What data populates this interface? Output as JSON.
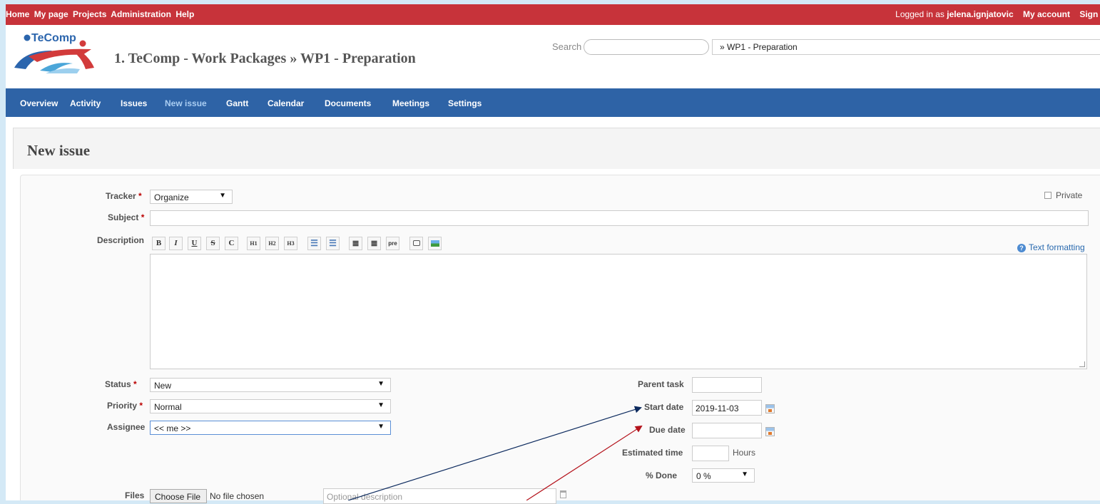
{
  "topbar": {
    "menu": [
      "Home",
      "My page",
      "Projects",
      "Administration",
      "Help"
    ],
    "logged_in_prefix": "Logged in as",
    "username": "jelena.ignjatovic",
    "my_account": "My account",
    "sign_out": "Sign o"
  },
  "header": {
    "logo_text": "TeComp",
    "project_title": "1. TeComp - Work Packages » WP1 - Preparation",
    "search_label": "Search",
    "search_value": "",
    "jump_value": "» WP1 - Preparation"
  },
  "main_menu": [
    {
      "label": "Overview"
    },
    {
      "label": "Activity"
    },
    {
      "label": "Issues"
    },
    {
      "label": "New issue",
      "active": true
    },
    {
      "label": "Gantt"
    },
    {
      "label": "Calendar"
    },
    {
      "label": "Documents"
    },
    {
      "label": "Meetings"
    },
    {
      "label": "Settings"
    }
  ],
  "page": {
    "title": "New issue"
  },
  "form": {
    "tracker": {
      "label": "Tracker",
      "value": "Organize"
    },
    "private_label": "Private",
    "subject": {
      "label": "Subject",
      "value": ""
    },
    "description": {
      "label": "Description",
      "value": ""
    },
    "toolbar": [
      "B",
      "I",
      "U",
      "S",
      "C",
      "H1",
      "H2",
      "H3",
      "ul",
      "ol",
      "left",
      "right",
      "pre",
      "link",
      "img"
    ],
    "text_formatting": "Text formatting",
    "status": {
      "label": "Status",
      "value": "New"
    },
    "priority": {
      "label": "Priority",
      "value": "Normal"
    },
    "assignee": {
      "label": "Assignee",
      "value": "<< me >>"
    },
    "parent_task": {
      "label": "Parent task",
      "value": ""
    },
    "start_date": {
      "label": "Start date",
      "value": "2019-11-03"
    },
    "due_date": {
      "label": "Due date",
      "value": ""
    },
    "estimated_time": {
      "label": "Estimated time",
      "value": "",
      "unit": "Hours"
    },
    "done": {
      "label": "% Done",
      "value": "0 %"
    },
    "files": {
      "label": "Files",
      "button": "Choose File",
      "status": "No file chosen",
      "desc_placeholder": "Optional description"
    },
    "required_marker": "*"
  },
  "colors": {
    "topbar": "#c7333a",
    "main_menu": "#2e63a6",
    "background": "#d4e9f6",
    "annotation_blue": "#0c2a5e",
    "annotation_red": "#b4121b"
  }
}
